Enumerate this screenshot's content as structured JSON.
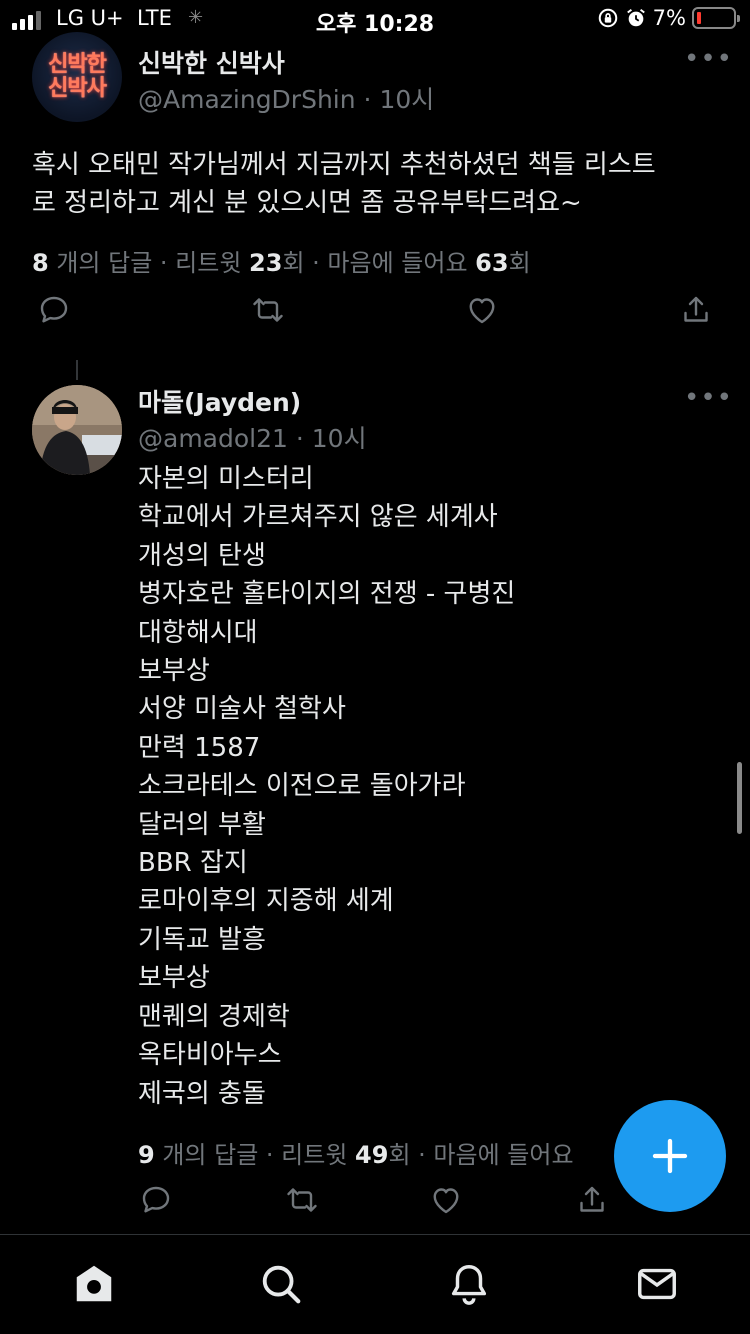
{
  "status_bar": {
    "carrier": "LG U+",
    "network": "LTE",
    "time": "오후 10:28",
    "battery": "7%",
    "battery_level": 0.07
  },
  "tweet1": {
    "avatar_text": [
      "신박한",
      "신박사"
    ],
    "name": "신박한 신박사",
    "handle": "@AmazingDrShin",
    "time": "· 10시",
    "text": "혹시 오태민 작가님께서 지금까지 추천하셨던 책들 리스트로 정리하고 계신 분 있으시면 좀 공유부탁드려요~",
    "text_line1": "혹시 오태민 작가님께서 지금까지 추천하셨던 책들 리스트",
    "text_line2": "로 정리하고 계신 분 있으시면 좀 공유부탁드려요~",
    "replies_count": "8",
    "replies_label": " 개의 답글",
    "retweets_prefix": " · 리트윗 ",
    "retweets_count": "23",
    "retweets_suffix": "회",
    "likes_prefix": " · 마음에 들어요 ",
    "likes_count": "63",
    "likes_suffix": "회"
  },
  "tweet2": {
    "name": "마돌(Jayden)",
    "handle": "@amadol21",
    "time": "· 10시",
    "books": [
      "자본의 미스터리",
      "학교에서 가르쳐주지 않은 세계사",
      "개성의 탄생",
      "병자호란 홀타이지의 전쟁 - 구병진",
      "대항해시대",
      "보부상",
      "서양 미술사 철학사",
      "만력 1587",
      "소크라테스 이전으로 돌아가라",
      "달러의 부활",
      "BBR 잡지",
      "로마이후의 지중해 세계",
      "기독교 발흥",
      "보부상",
      "맨퀘의 경제학",
      "옥타비아누스",
      "제국의 충돌"
    ],
    "replies_count": "9",
    "replies_label": " 개의 답글",
    "retweets_prefix": " · 리트윗 ",
    "retweets_count": "49",
    "retweets_suffix": "회",
    "likes_prefix": " · 마음에 들어요"
  },
  "icons": {
    "more": "more-icon",
    "reply": "reply-icon",
    "retweet": "retweet-icon",
    "like": "heart-icon",
    "share": "share-icon",
    "compose": "plus-icon",
    "home": "home-icon",
    "search": "search-icon",
    "notifications": "bell-icon",
    "messages": "mail-icon"
  },
  "colors": {
    "background": "#000000",
    "text": "#e7e9ea",
    "secondary": "#71767b",
    "accent": "#1d9bf0",
    "battery_low": "#ff3b30"
  }
}
